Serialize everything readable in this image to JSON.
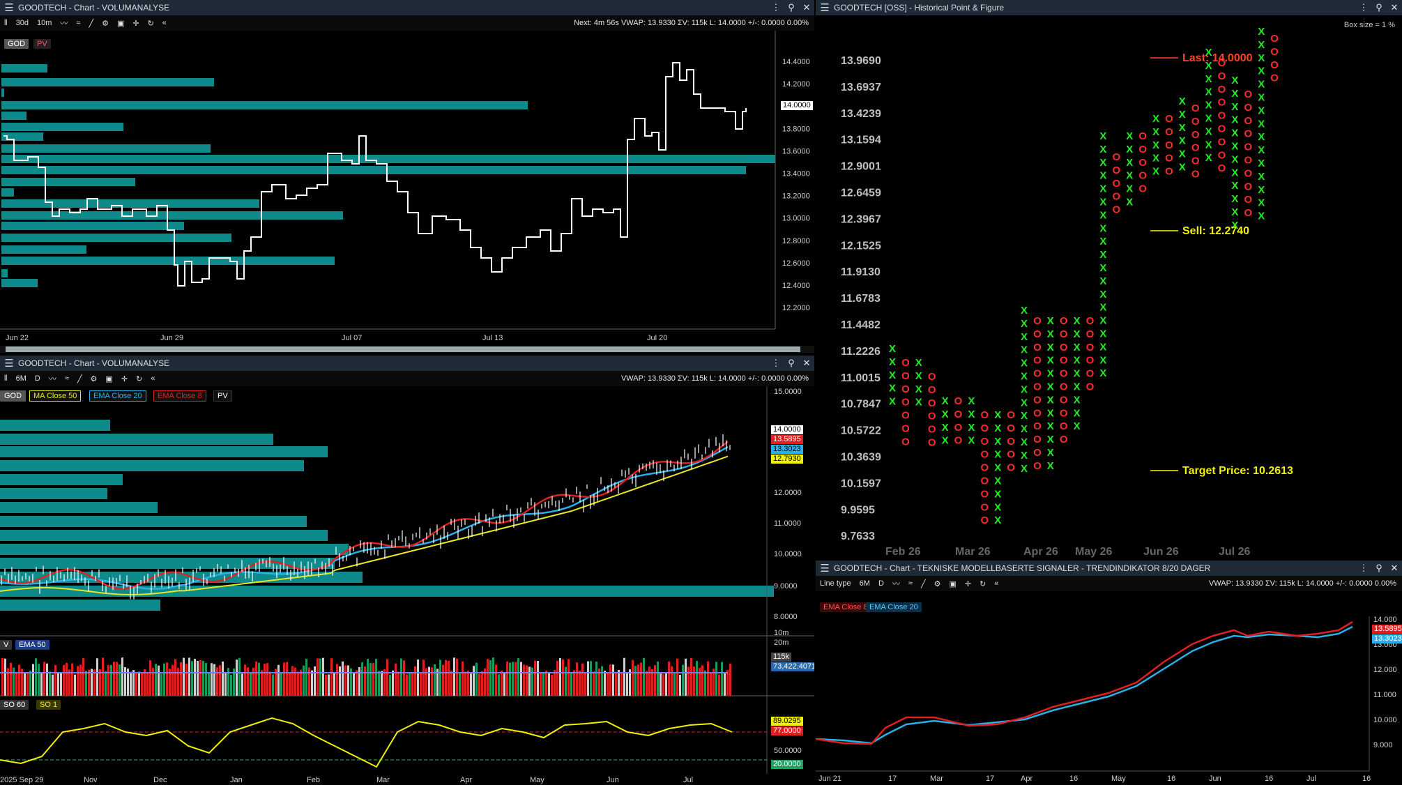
{
  "panel_tl": {
    "title": "GOODTECH - Chart - VOLUMANALYSE",
    "toolbar": {
      "period": "30d",
      "interval": "10m"
    },
    "status": "Next: 4m 56s  VWAP: 13.9330  ΣV: 115k  L: 14.0000  +/-: 0.0000  0.00%",
    "tags": [
      "GOD",
      "PV"
    ],
    "y_ticks": [
      "14.4000",
      "14.2000",
      "14.0000",
      "13.8000",
      "13.6000",
      "13.4000",
      "13.2000",
      "13.0000",
      "12.8000",
      "12.6000",
      "12.4000",
      "12.2000"
    ],
    "last_price": "14.0000",
    "x_ticks": [
      "Jun 22",
      "Jun 29",
      "Jul 07",
      "Jul 13",
      "Jul 20"
    ]
  },
  "panel_bl": {
    "title": "GOODTECH - Chart - VOLUMANALYSE",
    "toolbar": {
      "period": "6M",
      "interval": "D"
    },
    "status": "VWAP: 13.9330  ΣV: 115k  L: 14.0000  +/-: 0.0000  0.00%",
    "tags": [
      {
        "label": "GOD",
        "color": "#555555"
      },
      {
        "label": "MA Close 50",
        "color": "#e8e820"
      },
      {
        "label": "EMA Close 20",
        "color": "#2ab0e8"
      },
      {
        "label": "EMA Close 8",
        "color": "#e02020"
      },
      {
        "label": "PV",
        "color": "#333333"
      }
    ],
    "y_ticks": [
      "15.0000",
      "14.0000",
      "12.0000",
      "11.0000",
      "10.0000",
      "9.0000",
      "8.0000"
    ],
    "price_boxes": [
      {
        "value": "14.0000",
        "color": "#ffffff"
      },
      {
        "value": "13.5895",
        "color": "#e02020"
      },
      {
        "value": "13.3023",
        "color": "#2ab0e8"
      },
      {
        "value": "12.7930",
        "color": "#f0f000"
      }
    ],
    "volume": {
      "tags": [
        "V",
        "EMA 50"
      ],
      "ticks": [
        "20m",
        "10m"
      ],
      "boxes": [
        "115k",
        "73,422.4071"
      ]
    },
    "stoch": {
      "tags": [
        "SO 60",
        "SO 1"
      ],
      "ticks": [
        "50.0000"
      ],
      "boxes": [
        "89.0295",
        "77.0000",
        "20.0000"
      ]
    },
    "x_ticks": [
      "2025 Sep 29",
      "Nov",
      "Dec",
      "Jan",
      "Feb",
      "Mar",
      "Apr",
      "May",
      "Jun",
      "Jul"
    ]
  },
  "panel_r": {
    "title": "GOODTECH [OSS] - Historical Point & Figure",
    "box_size_label": "Box size = 1 %",
    "y_ticks": [
      "13.9690",
      "13.6937",
      "13.4239",
      "13.1594",
      "12.9001",
      "12.6459",
      "12.3967",
      "12.1525",
      "11.9130",
      "11.6783",
      "11.4482",
      "11.2226",
      "11.0015",
      "10.7847",
      "10.5722",
      "10.3639",
      "10.1597",
      "9.9595",
      "9.7633"
    ],
    "x_ticks": [
      "Feb 26",
      "Mar 26",
      "Apr 26",
      "May 26",
      "Jun 26",
      "Jul 26"
    ],
    "annotations": [
      {
        "label": "Last: 14.0000",
        "color": "#ff4422"
      },
      {
        "label": "Sell: 12.2740",
        "color": "#f0f000"
      },
      {
        "label": "Target Price: 10.2613",
        "color": "#f0f000"
      }
    ]
  },
  "panel_br": {
    "title": "GOODTECH - Chart - TEKNISKE MODELLBASERTE SIGNALER - TRENDINDIKATOR 8/20 DAGER",
    "toolbar": {
      "line_type": "Line type",
      "period": "6M",
      "interval": "D"
    },
    "status": "VWAP: 13.9330  ΣV: 115k  L: 14.0000  +/-: 0.0000  0.00%",
    "tags": [
      {
        "label": "EMA Close 8",
        "color": "#e02020"
      },
      {
        "label": "EMA Close 20",
        "color": "#2ab0e8"
      }
    ],
    "y_ticks": [
      "14.000",
      "13.000",
      "12.000",
      "11.000",
      "10.000",
      "9.000"
    ],
    "price_boxes": [
      {
        "value": "13.5895",
        "color": "#e02020"
      },
      {
        "value": "13.3023",
        "color": "#2ab0e8"
      }
    ],
    "x_ticks": [
      "Jun 21",
      "17",
      "Mar",
      "17",
      "Apr",
      "16",
      "May",
      "16",
      "Jun",
      "16",
      "Jul",
      "16"
    ]
  }
}
